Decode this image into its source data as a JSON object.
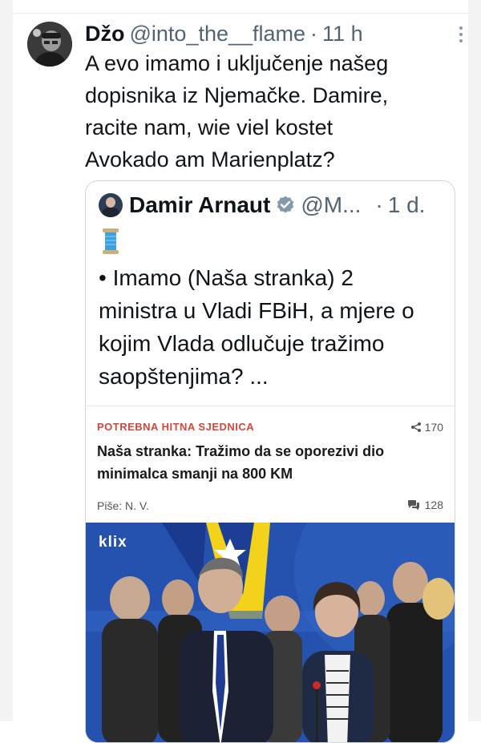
{
  "tweet": {
    "name": "Džo",
    "handle": "@into_the__flame",
    "separator": "·",
    "time": "11 h",
    "text": "A evo imamo i uključenje našeg\ndopisnika iz Njemačke. Damire,\nracite nam, wie viel kostet\nAvokado am Marienplatz?"
  },
  "quoted": {
    "name": "Damir Arnaut",
    "handle": "@M...",
    "separator": "·",
    "time": "1 d.",
    "emoji_icon": "spool-of-thread-icon",
    "text": "• Imamo (Naša stranka) 2\nministra u Vladi FBiH, a mjere o\nkojim Vlada odlučuje tražimo\nsaopštenjima? ..."
  },
  "article": {
    "kicker": "POTREBNA HITNA SJEDNICA",
    "shares": "170",
    "title": "Naša stranka: Tražimo da se oporezivi dio minimalca smanji na 800 KM",
    "author": "Piše: N. V.",
    "comments": "128",
    "photo_logo": "klix"
  },
  "colors": {
    "accent_kicker": "#d6453a",
    "verified": "#829aab",
    "text_secondary": "#536471",
    "photo_backdrop": "#1f4aa8"
  }
}
